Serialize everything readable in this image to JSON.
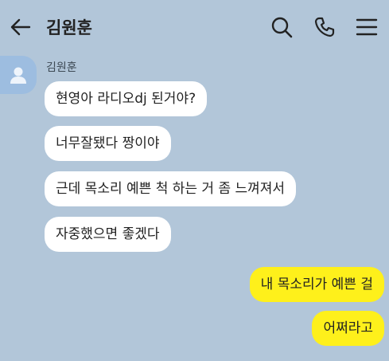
{
  "header": {
    "title": "김원훈",
    "icons": [
      "back-arrow-icon",
      "search-icon",
      "phone-icon",
      "menu-icon"
    ]
  },
  "chat": {
    "sender_name": "김원훈",
    "incoming": [
      "현영아 라디오dj 된거야?",
      "너무잘됐다 짱이야",
      "근데 목소리 예쁜 척 하는 거 좀 느껴져서",
      "자중했으면 좋겠다"
    ],
    "outgoing": [
      "내 목소리가 예쁜 걸",
      "어쩌라고"
    ]
  },
  "colors": {
    "background": "#b2c6d9",
    "incoming_bubble": "#ffffff",
    "outgoing_bubble": "#fef01b"
  }
}
